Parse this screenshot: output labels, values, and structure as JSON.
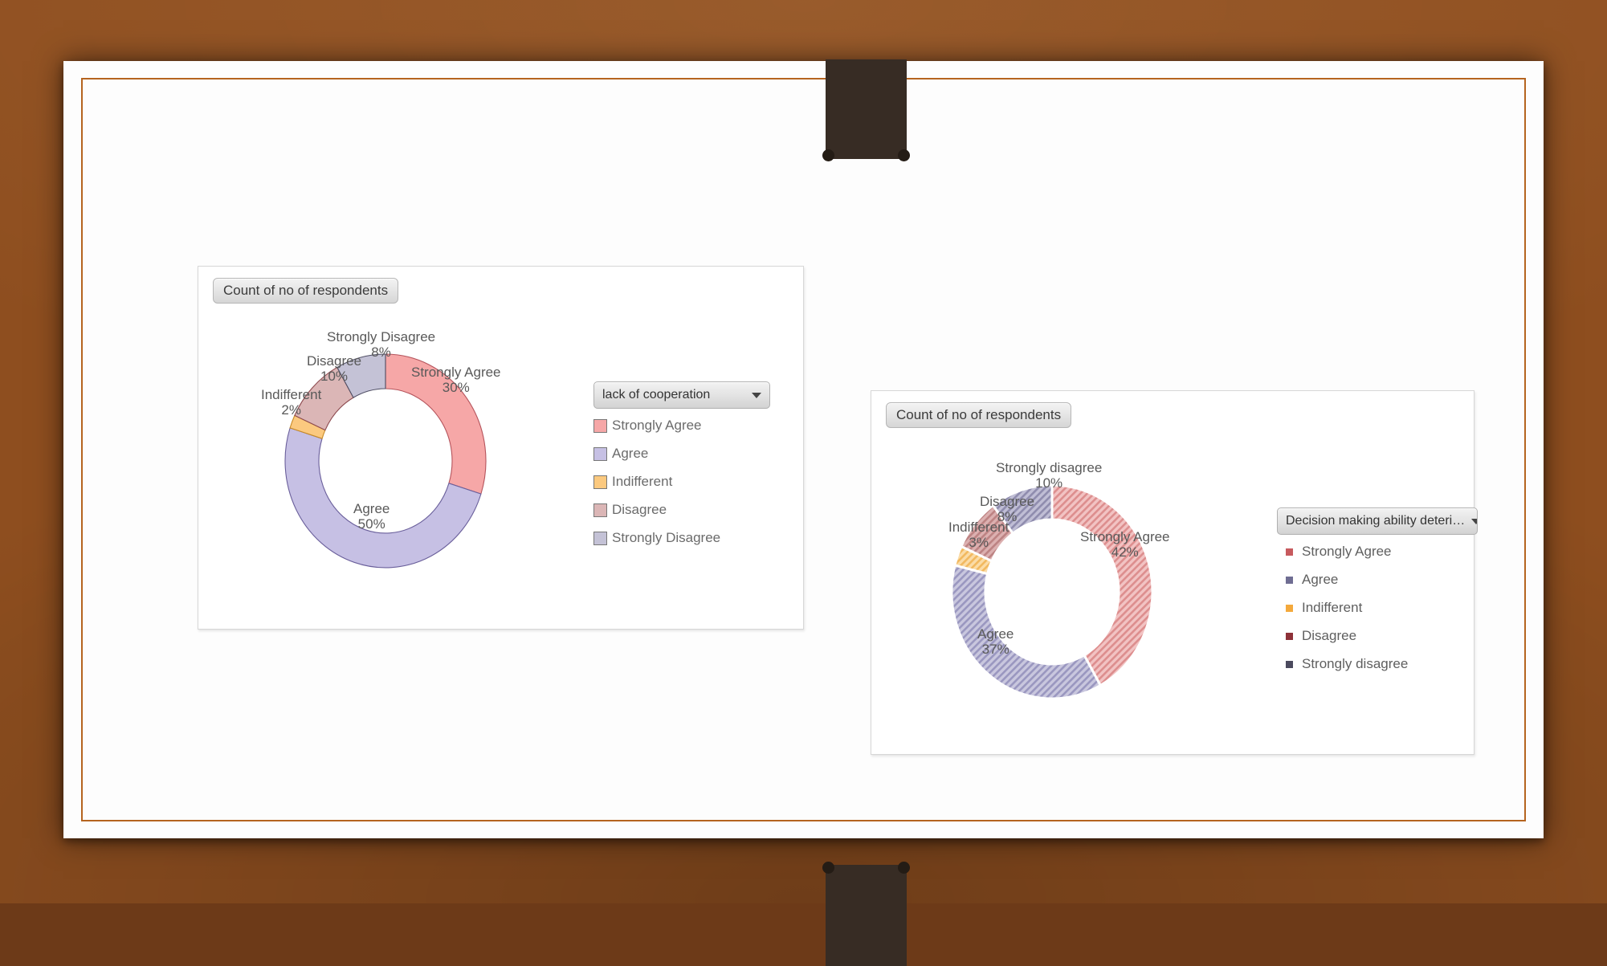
{
  "slide": {
    "background": "wood-desk",
    "page_color": "#fdfdfd",
    "border_color": "#b5641f",
    "strap_color": "#372c24"
  },
  "charts": [
    {
      "panel_id": "left",
      "header_pill": "Count of no of respondents",
      "filter_label": "lack of cooperation",
      "chart_data": {
        "type": "pie",
        "title": "Count of no of respondents",
        "subtitle": "lack of cooperation",
        "style": "doughnut",
        "legend_position": "right",
        "categories": [
          "Strongly Agree",
          "Agree",
          "Indifferent",
          "Disagree",
          "Strongly Disagree"
        ],
        "values": [
          30,
          50,
          2,
          10,
          8
        ],
        "value_labels": [
          "30%",
          "50%",
          "2%",
          "10%",
          "8%"
        ],
        "colors": [
          "#f6a7a7",
          "#c6c0e4",
          "#fbc97f",
          "#dbb6b6",
          "#c4c2d6"
        ],
        "stroke_colors": [
          "#b5545c",
          "#6a5f9b",
          "#c88a25",
          "#8d4a4f",
          "#4e4d63"
        ],
        "pattern": "solid",
        "start_angle_deg": 0,
        "direction": "clockwise"
      }
    },
    {
      "panel_id": "right",
      "header_pill": "Count of no of respondents",
      "filter_label": "Decision making ability deteri…",
      "chart_data": {
        "type": "pie",
        "title": "Count of no of respondents",
        "subtitle": "Decision making ability deteri…",
        "style": "doughnut",
        "legend_position": "right",
        "categories": [
          "Strongly Agree",
          "Agree",
          "Indifferent",
          "Disagree",
          "Strongly disagree"
        ],
        "values": [
          42,
          37,
          3,
          8,
          10
        ],
        "value_labels": [
          "42%",
          "37%",
          "3%",
          "8%",
          "10%"
        ],
        "colors": [
          "#e8a6a6",
          "#aeacd0",
          "#f7c97c",
          "#cc9a9a",
          "#a5a3bf"
        ],
        "legend_swatch_colors": [
          "#c75a5e",
          "#6f6d92",
          "#f4a93c",
          "#8e3138",
          "#4b4a5e"
        ],
        "pattern": "diagonal-hatch",
        "start_angle_deg": 0,
        "direction": "clockwise"
      }
    }
  ]
}
